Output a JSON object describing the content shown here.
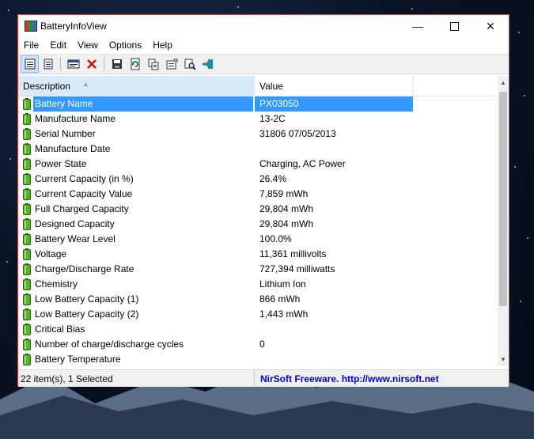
{
  "window": {
    "title": "BatteryInfoView",
    "minimize_symbol": "—",
    "close_symbol": "✕"
  },
  "menu": {
    "items": [
      "File",
      "Edit",
      "View",
      "Options",
      "Help"
    ]
  },
  "toolbar": {
    "icons": [
      "properties-view-icon",
      "html-report-icon",
      "battery-log-icon",
      "delete-icon",
      "save-icon",
      "refresh-icon",
      "copy-icon",
      "properties-icon",
      "find-icon",
      "exit-icon"
    ]
  },
  "list": {
    "columns": {
      "description": "Description",
      "sort_arrow": "▲",
      "value": "Value"
    },
    "rows": [
      {
        "description": "Battery Name",
        "value": "PX03050",
        "selected": true
      },
      {
        "description": "Manufacture Name",
        "value": "13-2C"
      },
      {
        "description": "Serial Number",
        "value": "31806 07/05/2013"
      },
      {
        "description": "Manufacture Date",
        "value": ""
      },
      {
        "description": "Power State",
        "value": "Charging, AC Power"
      },
      {
        "description": "Current Capacity (in %)",
        "value": "26.4%"
      },
      {
        "description": "Current Capacity Value",
        "value": "7,859 mWh"
      },
      {
        "description": "Full Charged Capacity",
        "value": "29,804 mWh"
      },
      {
        "description": "Designed Capacity",
        "value": "29,804 mWh"
      },
      {
        "description": "Battery Wear Level",
        "value": "100.0%"
      },
      {
        "description": "Voltage",
        "value": "11,361 millivolts"
      },
      {
        "description": "Charge/Discharge Rate",
        "value": "727,394 milliwatts"
      },
      {
        "description": "Chemistry",
        "value": "Lithium Ion"
      },
      {
        "description": "Low Battery Capacity (1)",
        "value": "866 mWh"
      },
      {
        "description": "Low Battery Capacity (2)",
        "value": "1,443 mWh"
      },
      {
        "description": "Critical Bias",
        "value": ""
      },
      {
        "description": "Number of charge/discharge cycles",
        "value": "0"
      },
      {
        "description": "Battery Temperature",
        "value": ""
      }
    ]
  },
  "scrollbar": {
    "up_symbol": "▲",
    "down_symbol": "▼"
  },
  "status": {
    "items_text": "22 item(s), 1 Selected",
    "credit": "NirSoft Freeware.  http://www.nirsoft.net"
  },
  "colors": {
    "selection": "#3399ff",
    "header_sorted": "#d9ebf9",
    "window_border": "#d9473d",
    "link": "#0000d8"
  }
}
